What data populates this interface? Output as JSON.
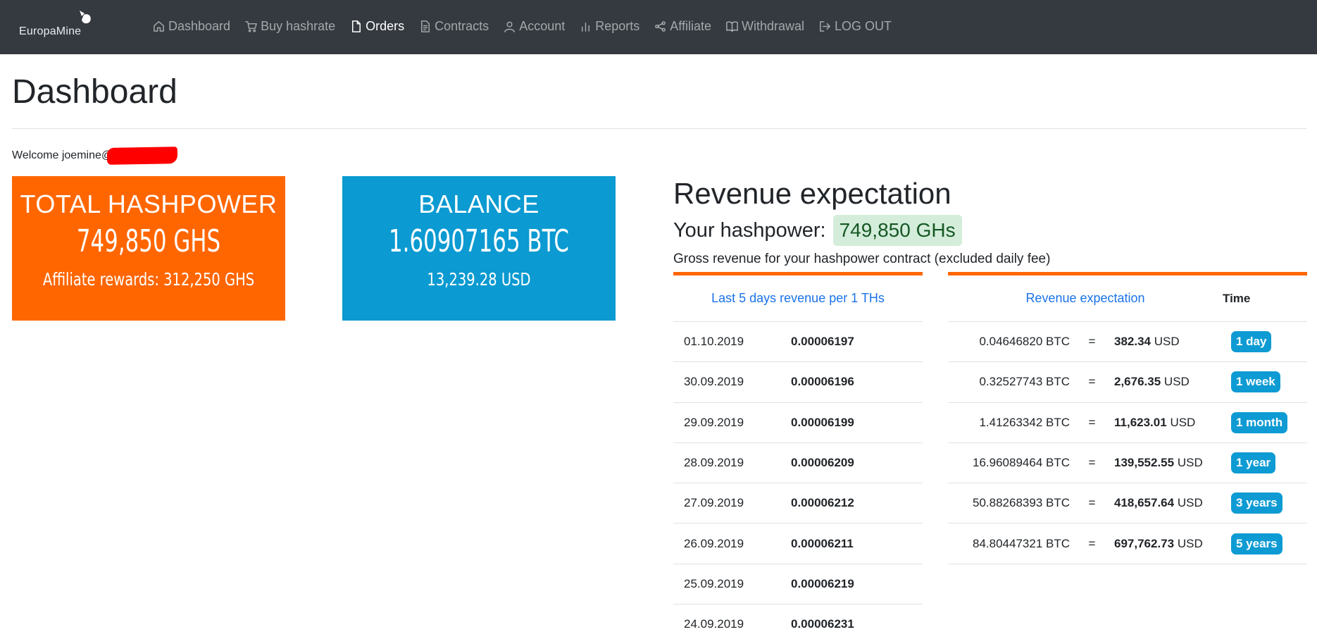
{
  "brand": {
    "name": "EuropaMine"
  },
  "nav": [
    {
      "label": "Dashboard",
      "icon": "home-icon"
    },
    {
      "label": "Buy hashrate",
      "icon": "cart-icon"
    },
    {
      "label": "Orders",
      "icon": "file-icon"
    },
    {
      "label": "Contracts",
      "icon": "file-text-icon"
    },
    {
      "label": "Account",
      "icon": "user-icon"
    },
    {
      "label": "Reports",
      "icon": "bar-chart-icon"
    },
    {
      "label": "Affiliate",
      "icon": "share-icon"
    },
    {
      "label": "Withdrawal",
      "icon": "book-icon"
    },
    {
      "label": "LOG OUT",
      "icon": "logout-icon"
    }
  ],
  "active_nav": "Orders",
  "page": {
    "title": "Dashboard",
    "welcome": "Welcome joemine@"
  },
  "hashpower_card": {
    "title": "TOTAL HASHPOWER",
    "value": "749,850 GHS",
    "sub": "Affiliate rewards: 312,250 GHS",
    "color": "#ff6600"
  },
  "balance_card": {
    "title": "BALANCE",
    "value": "1.60907165 BTC",
    "sub": "13,239.28 USD",
    "color": "#0b9ad1"
  },
  "revenue": {
    "heading": "Revenue expectation",
    "hashpower_label": "Your hashpower:",
    "hashpower_value": "749,850 GHs",
    "note": "Gross revenue for your hashpower contract (excluded daily fee)"
  },
  "history_table": {
    "header": "Last 5 days revenue per 1 THs",
    "rows": [
      {
        "date": "01.10.2019",
        "value": "0.00006197"
      },
      {
        "date": "30.09.2019",
        "value": "0.00006196"
      },
      {
        "date": "29.09.2019",
        "value": "0.00006199"
      },
      {
        "date": "28.09.2019",
        "value": "0.00006209"
      },
      {
        "date": "27.09.2019",
        "value": "0.00006212"
      },
      {
        "date": "26.09.2019",
        "value": "0.00006211"
      },
      {
        "date": "25.09.2019",
        "value": "0.00006219"
      },
      {
        "date": "24.09.2019",
        "value": "0.00006231"
      }
    ]
  },
  "expectation_table": {
    "header": "Revenue expectation",
    "time_header": "Time",
    "rows": [
      {
        "btc": "0.04646820 BTC",
        "eq": "=",
        "usd": "382.34",
        "unit": "USD",
        "period": "1 day"
      },
      {
        "btc": "0.32527743 BTC",
        "eq": "=",
        "usd": "2,676.35",
        "unit": "USD",
        "period": "1 week"
      },
      {
        "btc": "1.41263342 BTC",
        "eq": "=",
        "usd": "11,623.01",
        "unit": "USD",
        "period": "1 month"
      },
      {
        "btc": "16.96089464 BTC",
        "eq": "=",
        "usd": "139,552.55",
        "unit": "USD",
        "period": "1 year"
      },
      {
        "btc": "50.88268393 BTC",
        "eq": "=",
        "usd": "418,657.64",
        "unit": "USD",
        "period": "3 years"
      },
      {
        "btc": "84.80447321 BTC",
        "eq": "=",
        "usd": "697,762.73",
        "unit": "USD",
        "period": "5 years"
      }
    ]
  }
}
